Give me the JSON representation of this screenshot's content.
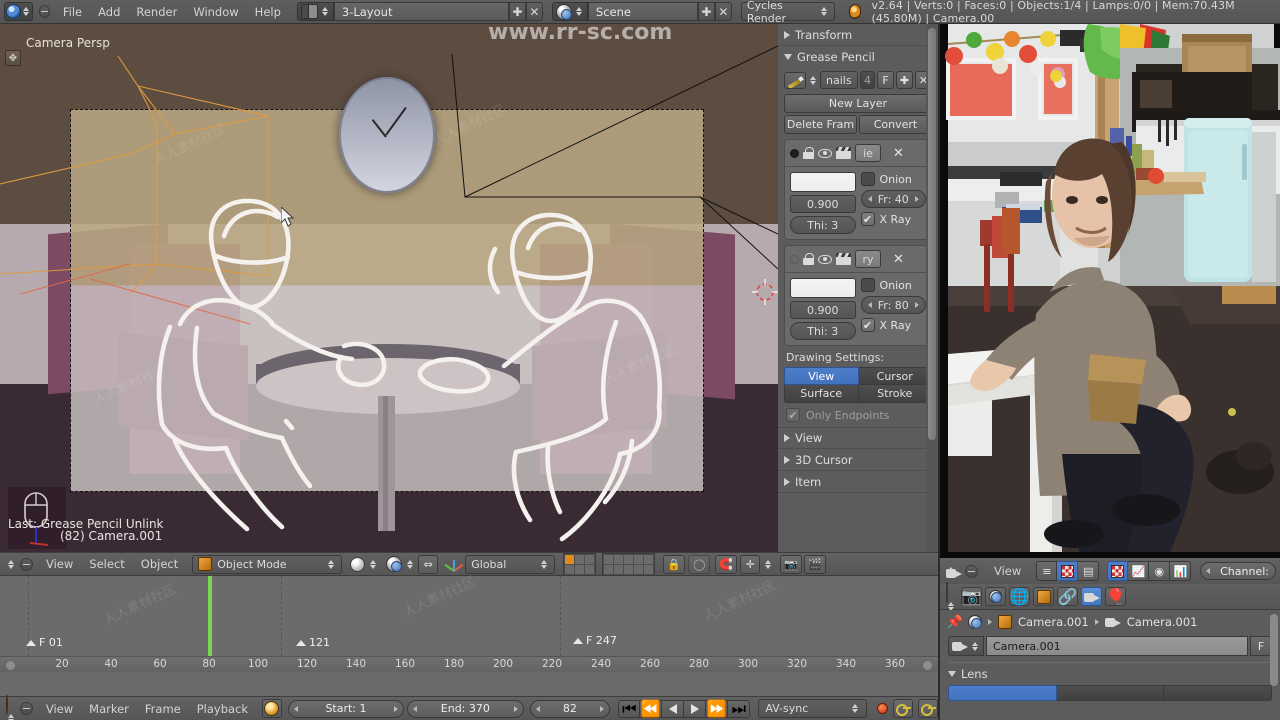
{
  "topbar": {
    "menus": [
      "File",
      "Add",
      "Render",
      "Window",
      "Help"
    ],
    "layout_value": "3-Layout",
    "scene_value": "Scene",
    "engine_value": "Cycles Render",
    "status": "v2.64 | Verts:0 | Faces:0 | Objects:1/4 | Lamps:0/0 | Mem:70.43M (45.80M) | Camera.00",
    "icons": {
      "blender": "blender-logo-icon",
      "screen": "screen-layout-icon",
      "scene": "scene-icon",
      "render": "render-engine-icon",
      "add": "plus-icon",
      "remove": "x-icon"
    }
  },
  "viewport": {
    "label": "Camera Persp",
    "last_operator": "Last: Grease Pencil Unlink",
    "active_object": "(82) Camera.001"
  },
  "viewport_header": {
    "menus": [
      "View",
      "Select",
      "Object"
    ],
    "mode_value": "Object Mode",
    "orientation_value": "Global"
  },
  "properties_panel": {
    "sections": [
      {
        "label": "Transform",
        "open": false
      },
      {
        "label": "Grease Pencil",
        "open": true
      }
    ],
    "grease_pencil": {
      "datablock_name": "nails",
      "users_count": "4",
      "fake_user": "F",
      "new_layer_label": "New Layer",
      "delete_frame_label": "Delete Fram",
      "convert_label": "Convert",
      "layers": [
        {
          "name": "ie",
          "active": true,
          "opacity": "0.900",
          "thickness": "Thi: 3",
          "onion_label": "Onion",
          "onion_frames": "Fr: 40",
          "xray_label": "X Ray",
          "xray_checked": true
        },
        {
          "name": "ry",
          "active": false,
          "opacity": "0.900",
          "thickness": "Thi: 3",
          "onion_label": "Onion",
          "onion_frames": "Fr: 80",
          "xray_label": "X Ray",
          "xray_checked": true
        }
      ],
      "drawing_settings_label": "Drawing Settings:",
      "drawing_modes": [
        "View",
        "Cursor",
        "Surface",
        "Stroke"
      ],
      "drawing_mode_selected": "View",
      "only_endpoints_label": "Only Endpoints",
      "only_endpoints_checked": true
    },
    "collapsed_sections": [
      "View",
      "3D Cursor",
      "Item"
    ]
  },
  "timeline": {
    "tick_labels": [
      "20",
      "40",
      "60",
      "80",
      "100",
      "120",
      "140",
      "160",
      "180",
      "200",
      "220",
      "240",
      "260",
      "280",
      "300",
      "320",
      "340",
      "360"
    ],
    "markers": [
      {
        "label": "F 01",
        "frame": 1
      },
      {
        "label": "121",
        "frame": 121
      },
      {
        "label": "F 247",
        "frame": 247
      }
    ],
    "menus": [
      "View",
      "Marker",
      "Frame",
      "Playback"
    ],
    "start_label": "Start: 1",
    "end_label": "End: 370",
    "current_frame": "82",
    "sync_value": "AV-sync",
    "playhead_frame": 82
  },
  "right_panel": {
    "image_editor": {
      "menu": "View",
      "channel_label": "Channel:"
    },
    "breadcrumb": [
      "Camera.001",
      "Camera.001"
    ],
    "datablock_name": "Camera.001",
    "fake_user": "F",
    "lens_section": "Lens",
    "tab_icons": [
      "render-icon",
      "scene-icon",
      "world-icon",
      "object-icon",
      "constraints-icon",
      "camera-data-icon",
      "physics-icon"
    ],
    "active_tab": "camera-data-icon"
  },
  "colors": {
    "accent_blue": "#4f7ec9",
    "playhead_green": "#79d659",
    "panel_bg": "#5c5c5c",
    "header_bg": "#5a5a5a",
    "wall": "#5d4c40",
    "sofa": "#8c5272"
  },
  "watermarks": [
    "www.rr-sc.com",
    "人人素材社区",
    "素材"
  ]
}
